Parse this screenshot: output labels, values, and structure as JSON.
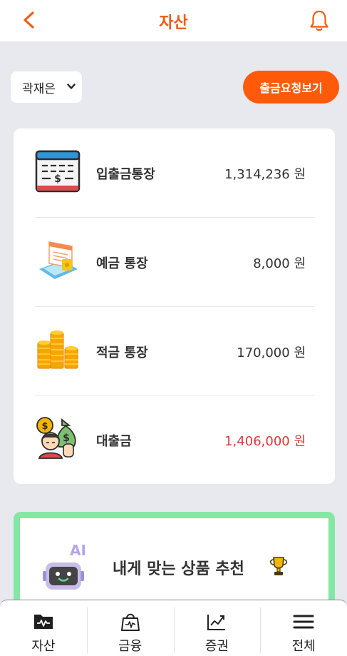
{
  "header": {
    "title": "자산",
    "back_icon": "chevron-left-icon",
    "bell_icon": "bell-icon",
    "accent": "#f05a14"
  },
  "user_select": {
    "value": "곽재은",
    "icon": "chevron-down-icon"
  },
  "withdraw_button": {
    "label": "출금요청보기",
    "color": "#ff5a0a"
  },
  "accounts": [
    {
      "name": "입출금통장",
      "amount": "1,314,236 원",
      "icon": "bank-book-icon"
    },
    {
      "name": "예금 통장",
      "amount": "8,000 원",
      "icon": "deposit-icon"
    },
    {
      "name": "적금 통장",
      "amount": "170,000 원",
      "icon": "coin-stack-icon"
    },
    {
      "name": "대출금",
      "amount": "1,406,000 원",
      "icon": "loan-icon",
      "amount_color": "#d63a3a"
    }
  ],
  "recommendation": {
    "text": "내게 맞는 상품 추천",
    "robot_icon": "ai-robot-icon",
    "trophy_icon": "trophy-icon",
    "border_color": "#83e8a4"
  },
  "bottom_nav": [
    {
      "label": "자산",
      "icon": "wallet-folder-icon"
    },
    {
      "label": "금융",
      "icon": "shopping-bag-icon"
    },
    {
      "label": "증권",
      "icon": "stock-chart-icon"
    },
    {
      "label": "전체",
      "icon": "hamburger-menu-icon"
    }
  ]
}
